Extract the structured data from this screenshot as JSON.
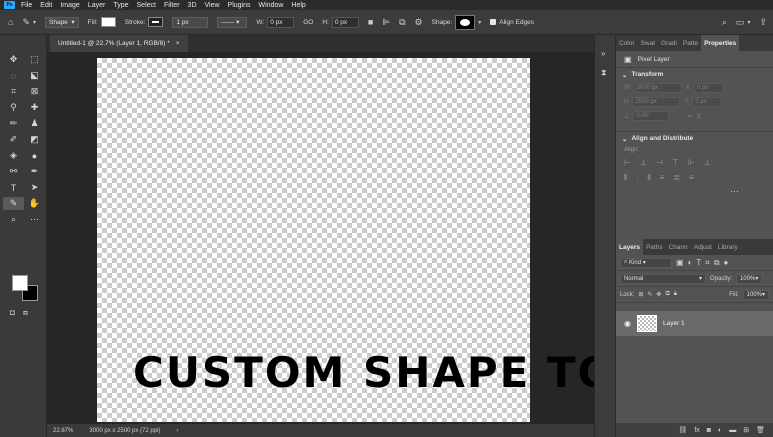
{
  "app": {
    "logo": "Ps"
  },
  "menu": [
    "File",
    "Edit",
    "Image",
    "Layer",
    "Type",
    "Select",
    "Filter",
    "3D",
    "View",
    "Plugins",
    "Window",
    "Help"
  ],
  "options": {
    "mode": "Shape",
    "fill_label": "Fill:",
    "stroke_label": "Stroke:",
    "stroke_width": "1 px",
    "w_label": "W:",
    "w_value": "0 px",
    "go_label": "GO",
    "h_label": "H:",
    "h_value": "0 px",
    "shape_label": "Shape:",
    "align_edges": "Align Edges"
  },
  "document": {
    "tab_title": "Untitled-1 @ 22.7% (Layer 1, RGB/8) *",
    "overlay_text": "CUSTOM SHAPE TOOL",
    "zoom": "22.67%",
    "size_info": "3000 px x 2500 px (72 ppi)"
  },
  "properties": {
    "tabs": [
      "Color",
      "Swat",
      "Gradi",
      "Patte",
      "Properties"
    ],
    "layer_type": "Pixel Layer",
    "transform_title": "Transform",
    "w_label": "W",
    "w_value": "3000 px",
    "h_label": "H",
    "h_value": "2500 px",
    "x_value": "0 px",
    "y_value": "0 px",
    "angle_value": "0.00°",
    "align_title": "Align and Distribute",
    "align_label": "Align:"
  },
  "layers_panel": {
    "tabs": [
      "Layers",
      "Paths",
      "Chann",
      "Adjust",
      "Library"
    ],
    "kind": "Kind",
    "blend_mode": "Normal",
    "opacity_label": "Opacity:",
    "opacity_value": "100%",
    "lock_label": "Lock:",
    "fill_label": "Fill:",
    "fill_value": "100%",
    "layer_name": "Layer 1"
  }
}
